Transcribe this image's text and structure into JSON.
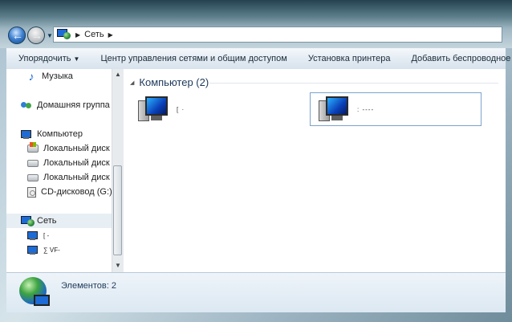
{
  "breadcrumb": {
    "location": "Сеть"
  },
  "toolbar": {
    "items": [
      {
        "label": "Упорядочить",
        "has_dropdown": true
      },
      {
        "label": "Центр управления сетями и общим доступом"
      },
      {
        "label": "Установка принтера"
      },
      {
        "label": "Добавить беспроводное устр"
      }
    ]
  },
  "sidebar": {
    "items": [
      {
        "label": "Музыка",
        "icon": "music-icon"
      },
      {
        "label": "Домашняя группа",
        "icon": "homegroup-icon"
      },
      {
        "label": "Компьютер",
        "icon": "computer-icon"
      },
      {
        "label": "Локальный диск (",
        "icon": "windows-drive-icon"
      },
      {
        "label": "Локальный диск (I",
        "icon": "drive-icon"
      },
      {
        "label": "Локальный диск (I",
        "icon": "drive-icon"
      },
      {
        "label": "CD-дисковод (G:)",
        "icon": "cd-drive-icon"
      },
      {
        "label": "Сеть",
        "icon": "network-icon"
      },
      {
        "label": "[ -",
        "icon": "computer-icon"
      },
      {
        "label": "∑ VF-",
        "icon": "computer-icon"
      }
    ]
  },
  "main": {
    "group_title": "Компьютер (2)",
    "computers": [
      {
        "name": "[ ·"
      },
      {
        "name": ": ----"
      }
    ]
  },
  "details": {
    "status": "Элементов: 2"
  }
}
